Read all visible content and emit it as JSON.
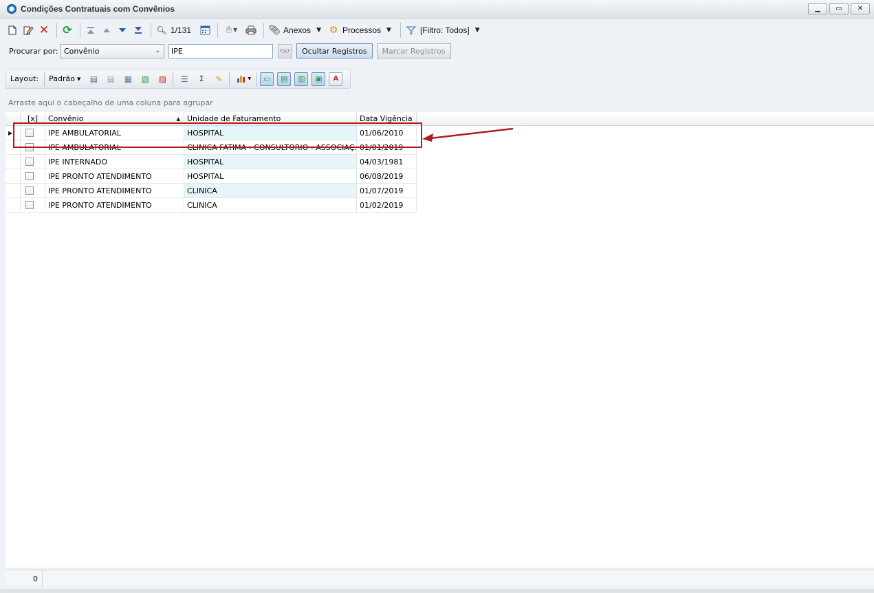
{
  "window": {
    "title": "Condições Contratuais com Convênios"
  },
  "toolbar": {
    "record_counter": "1/131",
    "anexos_label": "Anexos",
    "processos_label": "Processos",
    "filtro_label": "[Filtro: Todos]"
  },
  "search": {
    "label": "Procurar por:",
    "field_value": "Convênio",
    "input_value": "IPE",
    "hide_button": "Ocultar Registros",
    "mark_button": "Marcar Registros"
  },
  "layout_toolbar": {
    "layout_label": "Layout:",
    "preset_label": "Padrão"
  },
  "grid": {
    "group_hint": "Arraste aqui o cabeçalho de uma coluna para agrupar",
    "columns": {
      "check": "[x]",
      "convenio": "Convênio",
      "unidade": "Unidade de Faturamento",
      "data": "Data Vigência"
    },
    "rows": [
      {
        "convenio": "IPE AMBULATORIAL",
        "unidade": "HOSPITAL",
        "data": "01/06/2010"
      },
      {
        "convenio": "IPE AMBULATORIAL",
        "unidade": "CLINICA FATIMA - CONSULTORIO - ASSOCIAÇ...",
        "data": "01/01/2019"
      },
      {
        "convenio": "IPE INTERNADO",
        "unidade": "HOSPITAL",
        "data": "04/03/1981"
      },
      {
        "convenio": "IPE PRONTO ATENDIMENTO",
        "unidade": "HOSPITAL",
        "data": "06/08/2019"
      },
      {
        "convenio": "IPE PRONTO ATENDIMENTO",
        "unidade": "CLINICA",
        "data": "01/07/2019"
      },
      {
        "convenio": "IPE PRONTO ATENDIMENTO",
        "unidade": "CLINICA",
        "data": "01/02/2019"
      }
    ]
  },
  "footer": {
    "count": "0"
  },
  "colors": {
    "annotation": "#b31b1b",
    "row_highlight": "#e6f5f8"
  }
}
